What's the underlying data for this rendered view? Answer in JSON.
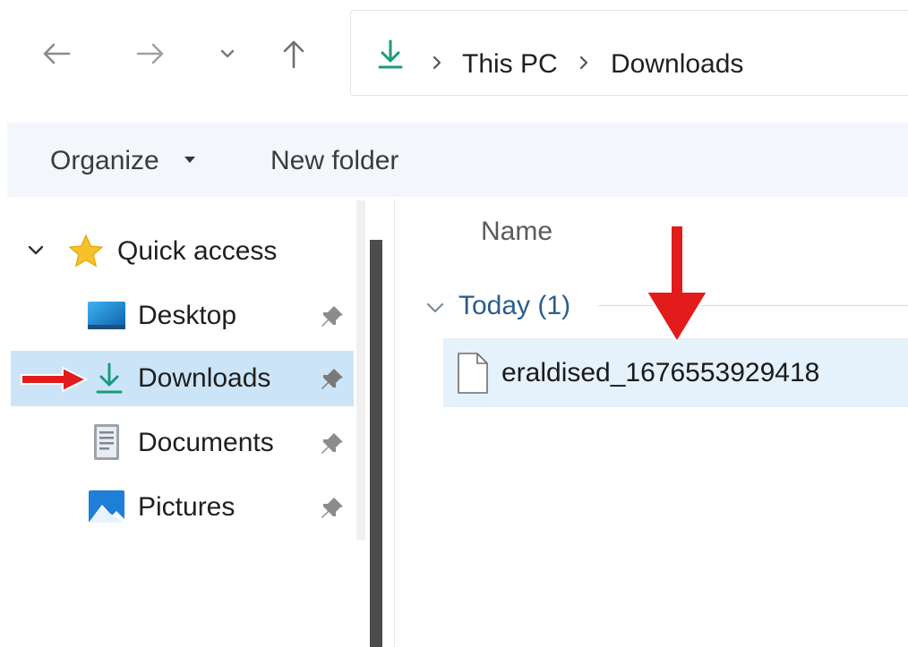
{
  "window": {
    "back_icon": "back-arrow-icon",
    "forward_icon": "forward-arrow-icon",
    "recent_icon": "chevron-down-icon",
    "up_icon": "up-arrow-icon"
  },
  "address_bar": {
    "location_icon": "download-icon",
    "breadcrumbs": [
      "This PC",
      "Downloads"
    ]
  },
  "command_bar": {
    "organize_label": "Organize",
    "new_folder_label": "New folder"
  },
  "nav_pane": {
    "quick_access_label": "Quick access",
    "items": [
      {
        "label": "Desktop",
        "icon": "desktop-icon"
      },
      {
        "label": "Downloads",
        "icon": "download-icon",
        "selected": true
      },
      {
        "label": "Documents",
        "icon": "documents-icon"
      },
      {
        "label": "Pictures",
        "icon": "pictures-icon"
      }
    ]
  },
  "content": {
    "column_name": "Name",
    "group_label": "Today (1)",
    "files": [
      {
        "name": "eraldised_1676553929418",
        "icon": "file-icon"
      }
    ]
  },
  "colors": {
    "accent_download": "#1b9a7b",
    "selection": "#cce4f7",
    "annotation_arrow": "#e21b1b"
  }
}
